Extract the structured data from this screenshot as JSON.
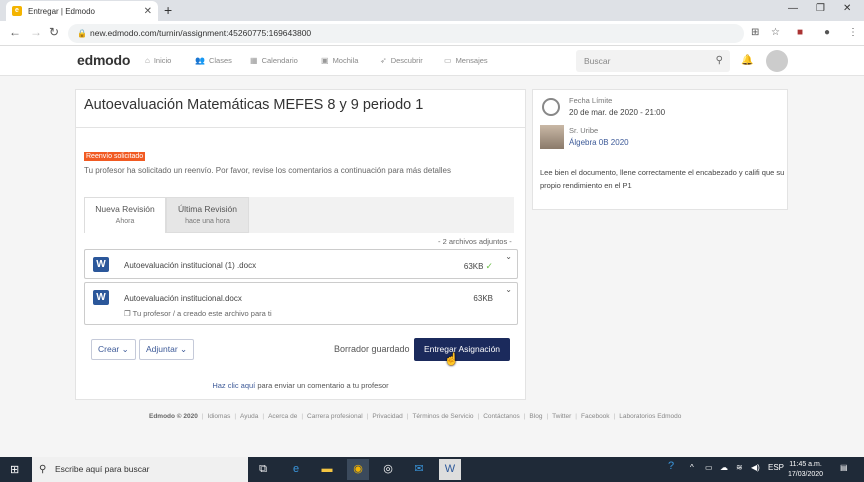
{
  "browser": {
    "tab_title": "Entregar | Edmodo",
    "url": "new.edmodo.com/turnin/assignment:45260775:169643800"
  },
  "header": {
    "logo": "edmodo",
    "nav": [
      {
        "label": "Inicio",
        "icon": "home-icon"
      },
      {
        "label": "Clases",
        "icon": "people-icon"
      },
      {
        "label": "Calendario",
        "icon": "calendar-icon"
      },
      {
        "label": "Mochila",
        "icon": "backpack-icon"
      },
      {
        "label": "Descubrir",
        "icon": "rocket-icon"
      },
      {
        "label": "Mensajes",
        "icon": "chat-icon"
      }
    ],
    "search_placeholder": "Buscar"
  },
  "assignment": {
    "title": "Autoevaluación Matemáticas MEFES 8 y 9 periodo 1",
    "badge": "Reenvío solicitado",
    "resubmit_text": "Tu profesor ha solicitado un reenvío. Por favor, revise los comentarios a continuación para más detalles",
    "tabs": [
      {
        "label": "Nueva Revisión",
        "sub": "Ahora"
      },
      {
        "label": "Última Revisión",
        "sub": "hace una hora"
      }
    ],
    "attachments_count": "- 2 archivos adjuntos  -",
    "files": [
      {
        "name": "Autoevaluación institucional (1) .docx",
        "size": "63KB"
      },
      {
        "name": "Autoevaluación institucional.docx",
        "size": "63KB",
        "note": "Tu profesor / a creado este archivo para ti"
      }
    ],
    "create_label": "Crear",
    "attach_label": "Adjuntar",
    "saved_label": "Borrador guardado",
    "submit_label": "Entregar Asignación",
    "comment_link": "Haz clic aquí",
    "comment_rest": " para enviar un comentario a tu profesor"
  },
  "sidebar": {
    "due_label": "Fecha Límite",
    "due_value": "20 de mar. de 2020 - 21:00",
    "teacher": "Sr. Uribe",
    "group": "Álgebra 0B 2020",
    "instructions": "Lee bien el documento, llene correctamente el encabezado y califi que su propio rendimiento en el P1"
  },
  "footer": {
    "copyright": "Edmodo © 2020",
    "links": [
      "Idiomas",
      "Ayuda",
      "Acerca de",
      "Carrera profesional",
      "Privacidad",
      "Términos de Servicio",
      "Contáctanos",
      "Blog",
      "Twitter",
      "Facebook",
      "Laboratorios Edmodo"
    ]
  },
  "taskbar": {
    "search_placeholder": "Escribe aquí para buscar",
    "lang": "ESP",
    "time": "11:45 a.m.",
    "date": "17/03/2020"
  }
}
